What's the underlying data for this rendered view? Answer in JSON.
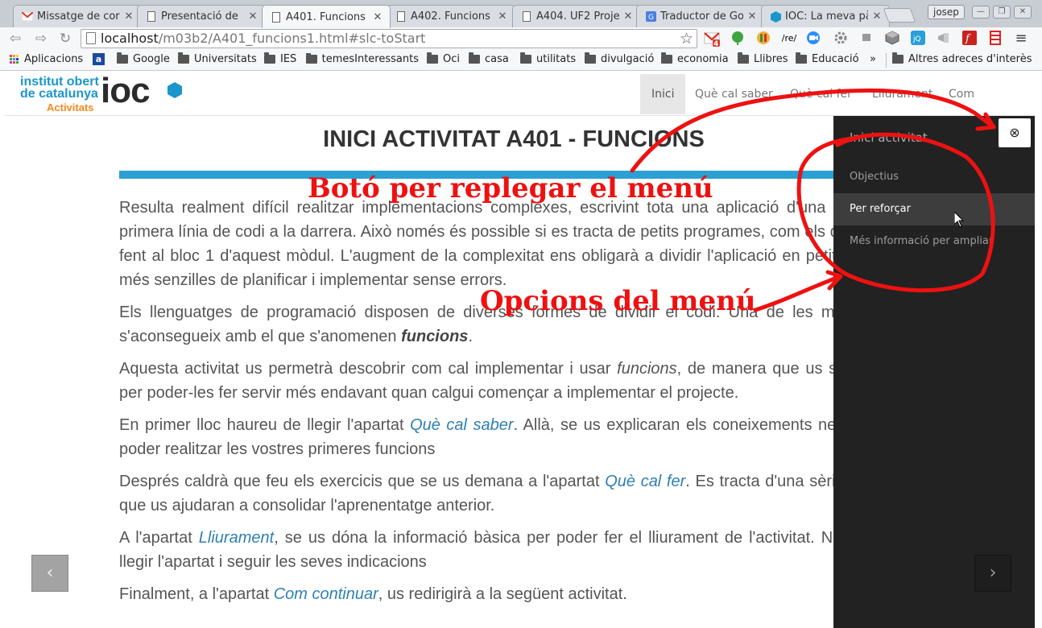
{
  "browser": {
    "tabs": [
      {
        "label": "Missatge de cor",
        "icon": "gmail-icon",
        "active": false
      },
      {
        "label": "Presentació de",
        "icon": "page-icon",
        "active": false
      },
      {
        "label": "A401. Funcions",
        "icon": "page-icon",
        "active": true
      },
      {
        "label": "A402. Funcions",
        "icon": "page-icon",
        "active": false
      },
      {
        "label": "A404. UF2 Proje",
        "icon": "page-icon",
        "active": false
      },
      {
        "label": "Traductor de Go",
        "icon": "google-translate-icon",
        "active": false
      },
      {
        "label": "IOC: La meva pà",
        "icon": "ioc-icon",
        "active": false
      }
    ],
    "profile": "josep",
    "url_host": "localhost",
    "url_path": "/m03b2/A401_funcions1.html#slc-toStart",
    "gmail_badge": "4",
    "extension_re_label": "/re/",
    "bookmarks": [
      {
        "label": "Aplicacions",
        "icon": "apps-icon"
      },
      {
        "label": "",
        "icon": "amazon-icon"
      },
      {
        "label": "Google",
        "icon": "folder-icon"
      },
      {
        "label": "Universitats",
        "icon": "folder-icon"
      },
      {
        "label": "IES",
        "icon": "folder-icon"
      },
      {
        "label": "temesInteressants",
        "icon": "folder-icon"
      },
      {
        "label": "Oci",
        "icon": "folder-icon"
      },
      {
        "label": "casa",
        "icon": "folder-icon"
      },
      {
        "label": "utilitats",
        "icon": "folder-icon"
      },
      {
        "label": "divulgació",
        "icon": "folder-icon"
      },
      {
        "label": "economia",
        "icon": "folder-icon"
      },
      {
        "label": "Llibres",
        "icon": "folder-icon"
      },
      {
        "label": "Educació",
        "icon": "folder-icon"
      }
    ],
    "bookmarks_overflow": "»",
    "other_bookmarks": "Altres adreces d'interès"
  },
  "site": {
    "logo_line1": "institut obert",
    "logo_line2": "de catalunya",
    "logo_sub": "Activitats",
    "logo_mark": "ioc",
    "nav": [
      {
        "label": "Inici",
        "active": true
      },
      {
        "label": "Què cal saber",
        "active": false
      },
      {
        "label": "Què cal fer",
        "active": false
      },
      {
        "label": "Lliurament",
        "active": false
      },
      {
        "label": "Com continuar",
        "active": false
      }
    ]
  },
  "main": {
    "title": "INICI ACTIVITAT A401 - FUNCIONS",
    "paragraphs": [
      "Resulta realment difícil realitzar implementacions complexes, escrivint tota una aplicació d'una tirada, de la primera línia de codi a la darrera. Això només és possible si es tracta de petits programes, com els que heu anat fent al bloc 1 d'aquest mòdul. L'augment de la complexitat ens obligarà a dividir l'aplicació en petites porcions, més senzilles de planificar i implementar sense errors.",
      "Els llenguatges de programació disposen de diverses formes de dividir el codi. Una de les més habituals s'aconsegueix amb el que s'anomenen",
      "funcions",
      "Aquesta activitat us permetrà descobrir com cal implementar i usar",
      "funcions",
      ", de manera que us sigui pràctica per poder-les fer servir més endavant quan calgui començar a implementar el projecte.",
      "En primer lloc haureu de llegir l'apartat",
      "Què cal saber",
      ". Allà, se us explicaran els coneixements necessaris per poder realitzar les vostres primeres funcions",
      "Després caldrà que feu els exercicis que se us demana a l'apartat",
      "Què cal fer",
      ". Es tracta d'una sèrie d'exercicis que us ajudaran a consolidar l'aprenentatge anterior.",
      "A l'apartat",
      "Lliurament",
      ", se us dóna la informació bàsica per poder fer el lliurament de l'activitat. No oblideu de llegir l'apartat i seguir les seves indicacions",
      "Finalment, a l'apartat",
      "Com continuar",
      ", us redirigirà a la següent activitat."
    ],
    "prev_glyph": "‹",
    "next_glyph": "›"
  },
  "side_menu": {
    "title": "Inici activitat",
    "items": [
      {
        "label": "Objectius",
        "hover": false
      },
      {
        "label": "Per reforçar",
        "hover": true
      },
      {
        "label": "Més informació per ampliar",
        "hover": false
      }
    ],
    "close_glyph": "⊗"
  },
  "annotations": {
    "collapse_button": "Botó per replegar el menú",
    "menu_options": "Opcions del menú",
    "color": "#ee1111"
  }
}
